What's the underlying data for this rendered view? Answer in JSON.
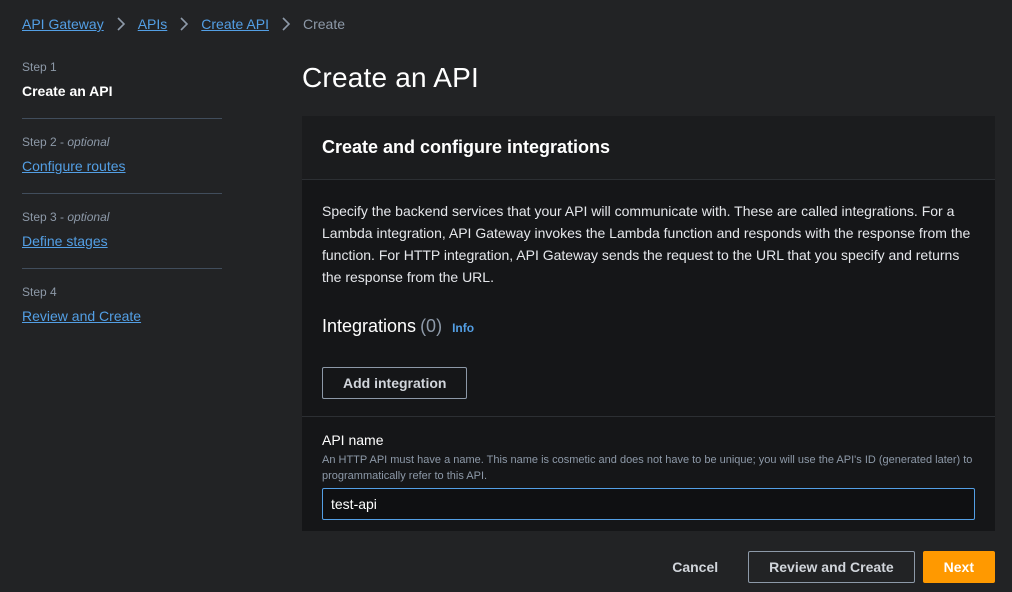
{
  "breadcrumb": {
    "items": [
      {
        "label": "API Gateway"
      },
      {
        "label": "APIs"
      },
      {
        "label": "Create API"
      }
    ],
    "current": "Create",
    "separator_icon": "chevron-right-icon"
  },
  "steps": [
    {
      "num": "Step 1",
      "optional": "",
      "title": "Create an API"
    },
    {
      "num": "Step 2",
      "optional": "optional",
      "title": "Configure routes"
    },
    {
      "num": "Step 3",
      "optional": "optional",
      "title": "Define stages"
    },
    {
      "num": "Step 4",
      "optional": "",
      "title": "Review and Create"
    }
  ],
  "page": {
    "title": "Create an API"
  },
  "panel": {
    "header": "Create and configure integrations",
    "description": "Specify the backend services that your API will communicate with. These are called integrations. For a Lambda integration, API Gateway invokes the Lambda function and responds with the response from the function. For HTTP integration, API Gateway sends the request to the URL that you specify and returns the response from the URL.",
    "integrations_title": "Integrations",
    "integrations_count": "(0)",
    "info_label": "Info",
    "add_integration_label": "Add integration",
    "api_name_label": "API name",
    "api_name_hint": "An HTTP API must have a name. This name is cosmetic and does not have to be unique; you will use the API's ID (generated later) to programmatically refer to this API.",
    "api_name_value": "test-api"
  },
  "footer": {
    "cancel_label": "Cancel",
    "review_label": "Review and Create",
    "next_label": "Next"
  },
  "colors": {
    "background": "#222325",
    "panel": "#151618",
    "link": "#539fe5",
    "primary": "#ff9900",
    "border": "#8d99a8"
  }
}
